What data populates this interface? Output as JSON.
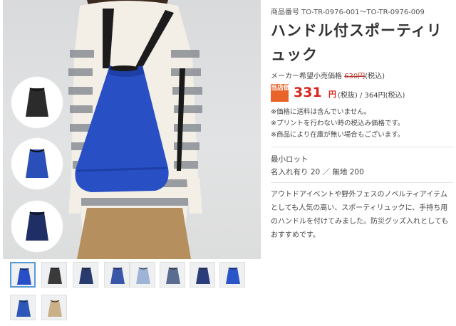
{
  "product": {
    "sku": "商品番号 TO-TR-0976-001〜TO-TR-0976-009",
    "title": "ハンドル付スポーティリュック",
    "maker_price_label": "メーカー希望小売価格",
    "maker_price": "630円",
    "maker_price_tax": "(税込)",
    "store_badge": "当店価格",
    "price": "331",
    "price_unit": "円",
    "price_rest": "(税抜) / 364円(税込)",
    "notes": [
      "※価格に送料は含んでいません。",
      "※プリントを行わない時の税込み価格です。",
      "※商品により在庫が無い場合もございます。"
    ],
    "min_lot_label": "最小ロット",
    "min_lot_value": "名入れ有り 20 ／ 無地 200",
    "description": "アウトドアイベントや野外フェスのノベルティアイテムとしても人気の高い、スポーティリュックに、手持ち用のハンドルを付けてみました。防災グッズ入れとしてもおすすめです。"
  },
  "swatches": [
    {
      "name": "black",
      "color": "#2b2b2b"
    },
    {
      "name": "royal-blue",
      "color": "#2a4fb8"
    },
    {
      "name": "navy",
      "color": "#1f2f66"
    }
  ],
  "thumbnails": [
    {
      "name": "royal-blue",
      "color": "#2750c8"
    },
    {
      "name": "black",
      "color": "#3a3a3a"
    },
    {
      "name": "navy",
      "color": "#283a6e"
    },
    {
      "name": "blue",
      "color": "#3a56a8"
    },
    {
      "name": "detail-1",
      "color": "#9fb3d6"
    },
    {
      "name": "detail-2",
      "color": "#5a6c8f"
    },
    {
      "name": "print-sample",
      "color": "#2a3c7a"
    },
    {
      "name": "model-back",
      "color": "#2a55c6"
    },
    {
      "name": "model-side",
      "color": "#2e56b8"
    },
    {
      "name": "model-outdoor",
      "color": "#c9b087"
    }
  ]
}
